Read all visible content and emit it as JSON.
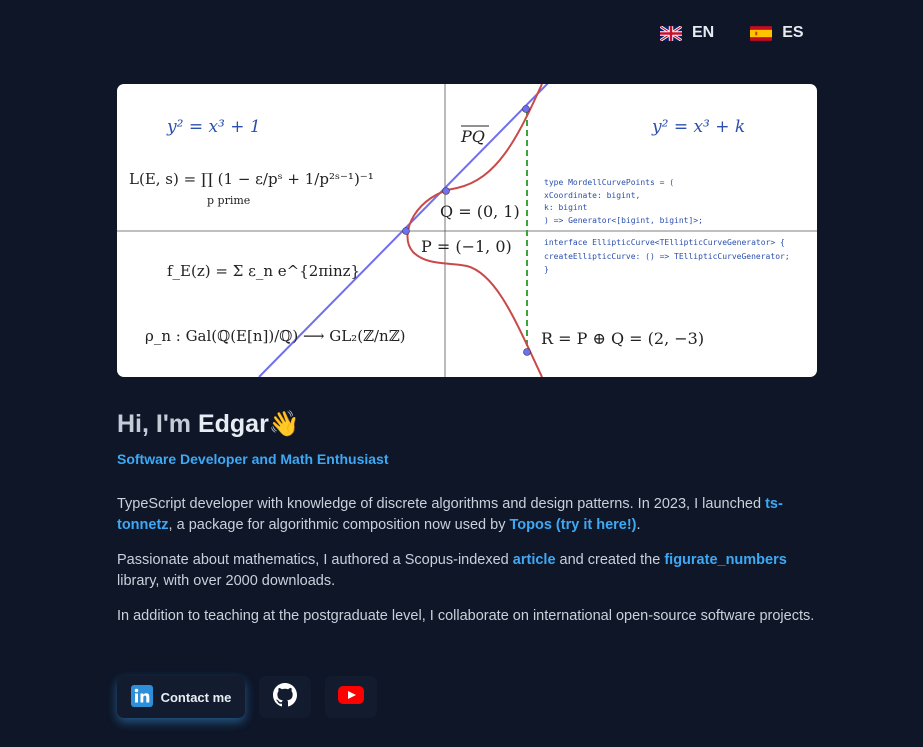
{
  "languages": [
    {
      "code": "EN",
      "flag": "uk-flag-icon"
    },
    {
      "code": "ES",
      "flag": "spain-flag-icon"
    }
  ],
  "hero": {
    "eq_left": "y² = x³ + 1",
    "eq_right": "y² = x³ + k",
    "l_function": "L(E, s) = ∏ (1 − ε/pˢ + 1/p²ˢ⁻¹)⁻¹",
    "product_sub": "p prime",
    "modular_form": "f_E(z) = Σ ε_n e^{2πinz}",
    "galois_rep": "ρ_n : Gal(ℚ(E[n])/ℚ) ⟶ GL₂(ℤ/nℤ)",
    "label_pq": "PQ",
    "label_q": "Q = (0, 1)",
    "label_p": "P = (−1, 0)",
    "label_r": "R = P ⊕ Q = (2, −3)",
    "code_lines_1": [
      "type MordellCurvePoints = (",
      "  xCoordinate: bigint,",
      "  k: bigint",
      ") => Generator<[bigint, bigint]>;"
    ],
    "code_lines_2": [
      "interface EllipticCurve<TEllipticCurveGenerator> {",
      "  createEllipticCurve: () => TEllipticCurveGenerator;",
      "}"
    ]
  },
  "greeting": {
    "prefix": "Hi, I'm",
    "name": "Edgar",
    "emoji": "👋"
  },
  "subtitle": "Software Developer and Math Enthusiast",
  "bio": {
    "p1_a": "TypeScript developer with knowledge of discrete algorithms and design patterns. In 2023, I launched ",
    "p1_link1": "ts-tonnetz",
    "p1_b": ", a package for algorithmic composition now used by ",
    "p1_link2": "Topos (try it here!)",
    "p1_c": ".",
    "p2_a": "Passionate about mathematics, I authored a Scopus-indexed ",
    "p2_link1": "article",
    "p2_b": " and created the ",
    "p2_link2": "figurate_numbers",
    "p2_c": " library, with over 2000 downloads.",
    "p3": "In addition to teaching at the postgraduate level, I collaborate on international open-source software projects."
  },
  "actions": {
    "contact_label": "Contact me",
    "contact_icon": "linkedin-icon",
    "github_icon": "github-icon",
    "youtube_icon": "youtube-icon"
  },
  "colors": {
    "background": "#0e1628",
    "accent": "#3da9f5",
    "curve": "#c94a4a",
    "line": "#6f6ff0",
    "dashed": "#3aa63a"
  }
}
